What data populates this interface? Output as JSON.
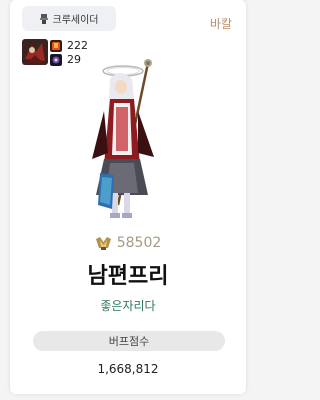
{
  "job": {
    "label": "크루세이더",
    "icon": "crusader-icon"
  },
  "server": "바칼",
  "stats": [
    {
      "value": "222",
      "icon": "orange-item-icon"
    },
    {
      "value": "29",
      "icon": "dark-item-icon"
    }
  ],
  "fame": {
    "icon": "fame-badge-icon",
    "value": "58502"
  },
  "character": {
    "name": "남편프리",
    "guild": "좋은자리다"
  },
  "buff": {
    "label": "버프점수",
    "value": "1,668,812"
  },
  "colors": {
    "server": "#b89064",
    "guild": "#2f7864",
    "fame": "#a59a83"
  }
}
